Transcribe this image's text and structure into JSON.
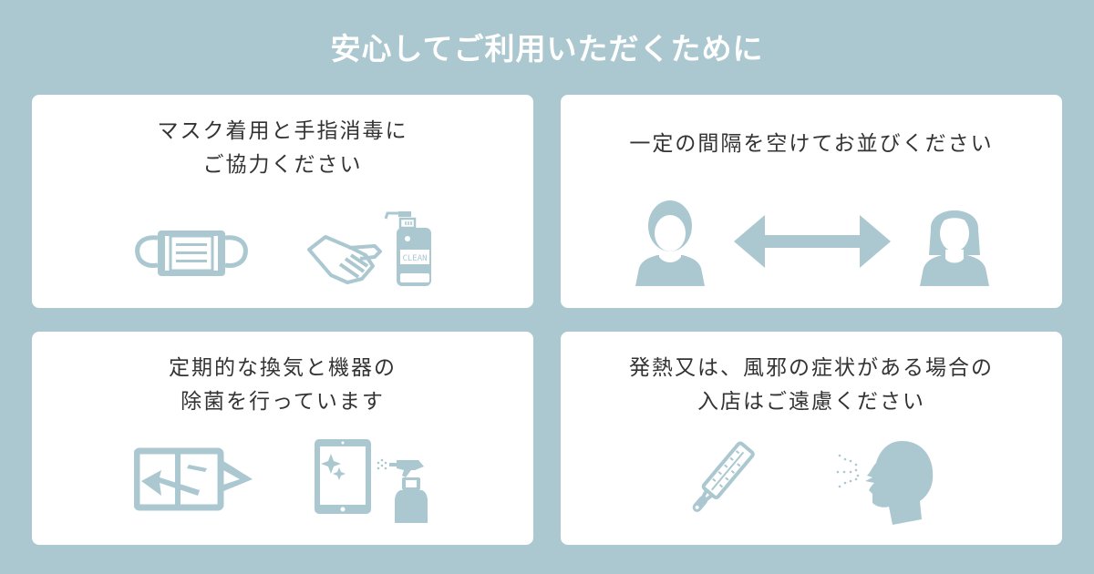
{
  "header": {
    "title": "安心してご利用いただくために"
  },
  "colors": {
    "background": "#abc8d0",
    "card": "#ffffff",
    "icon": "#abc8d0",
    "text": "#333333",
    "title": "#ffffff"
  },
  "cards": [
    {
      "lines": [
        "マスク着用と手指消毒に",
        "ご協力ください"
      ],
      "icons": [
        "face-mask-icon",
        "hand-sanitizer-icon"
      ],
      "bottle_label": "CLEAN"
    },
    {
      "lines": [
        "一定の間隔を空けてお並びください"
      ],
      "icons": [
        "man-icon",
        "double-arrow-icon",
        "woman-icon"
      ]
    },
    {
      "lines": [
        "定期的な換気と機器の",
        "除菌を行っています"
      ],
      "icons": [
        "window-ventilation-icon",
        "tablet-icon",
        "spray-bottle-icon"
      ]
    },
    {
      "lines": [
        "発熱又は、風邪の症状がある場合の",
        "入店はご遠慮ください"
      ],
      "icons": [
        "thermometer-icon",
        "coughing-person-icon"
      ]
    }
  ]
}
